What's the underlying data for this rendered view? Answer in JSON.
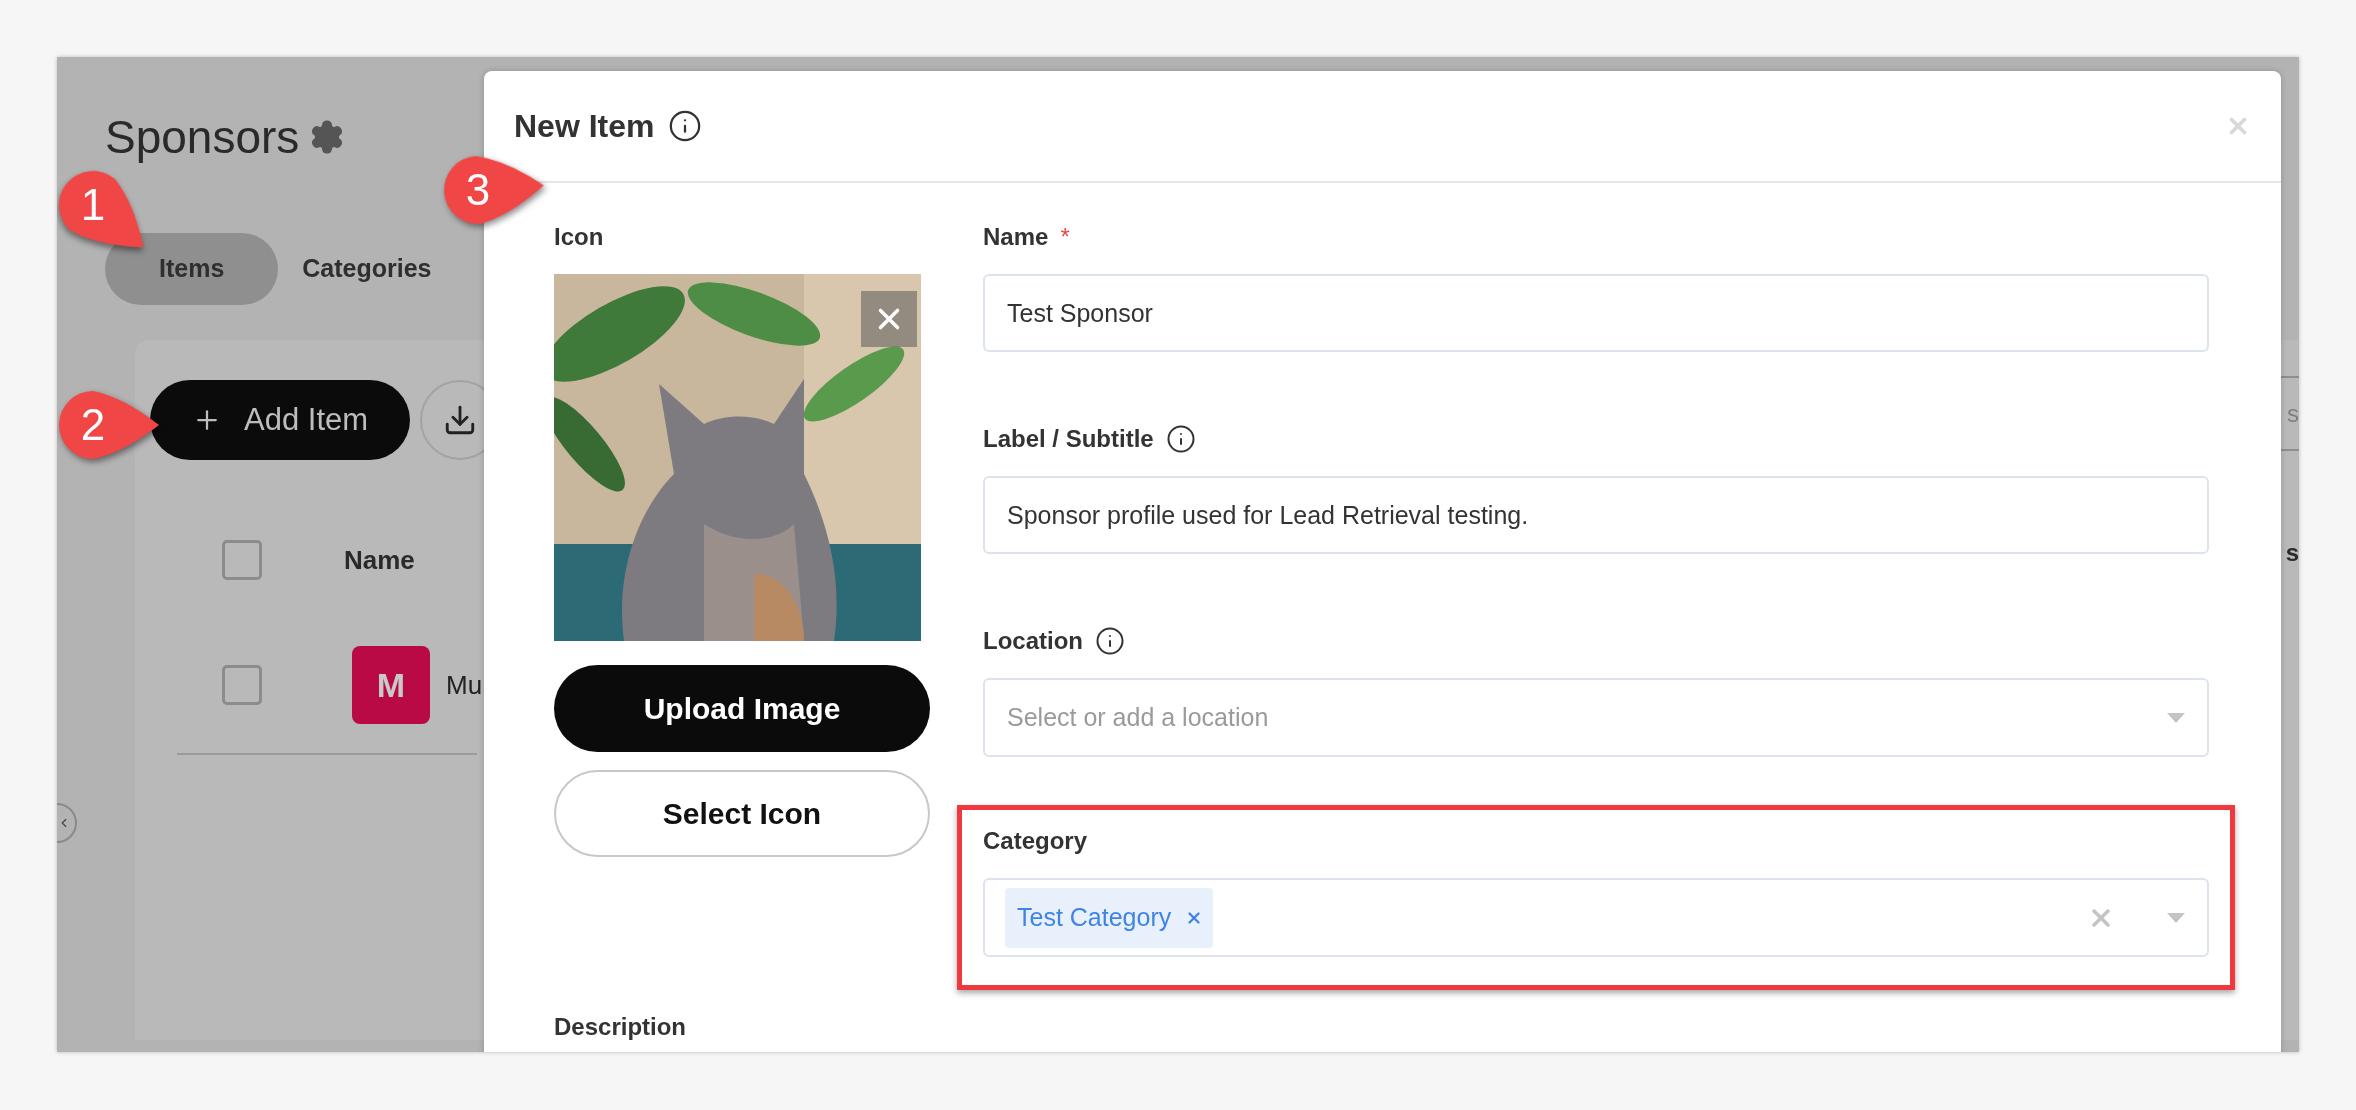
{
  "page": {
    "title": "Sponsors",
    "tabs": [
      {
        "label": "Items",
        "selected": true
      },
      {
        "label": "Categories",
        "selected": false
      }
    ],
    "add_button": "Add Item",
    "table": {
      "header_checked": false,
      "columns": [
        "Name"
      ],
      "rows": [
        {
          "logo_letter": "M",
          "name": "Mu",
          "checked": false
        }
      ]
    },
    "right_edge_texts": [
      "s",
      "s"
    ]
  },
  "modal": {
    "title": "New Item",
    "icon_label": "Icon",
    "upload_button": "Upload Image",
    "select_icon_button": "Select Icon",
    "fields": [
      {
        "kind": "text",
        "label": "Name",
        "required_mark": "*",
        "info": false,
        "highlighted": false,
        "value": "Test Sponsor"
      },
      {
        "kind": "text",
        "label": "Label / Subtitle",
        "info": true,
        "highlighted": false,
        "value": "Sponsor profile used for Lead Retrieval testing."
      },
      {
        "kind": "select",
        "label": "Location",
        "info": true,
        "highlighted": false,
        "placeholder": "Select or add a location"
      },
      {
        "kind": "multiselect",
        "label": "Category",
        "info": false,
        "highlighted": true,
        "tags": [
          "Test Category"
        ]
      }
    ],
    "description_label": "Description"
  },
  "callouts": [
    {
      "number": "1"
    },
    {
      "number": "2"
    },
    {
      "number": "3"
    }
  ]
}
